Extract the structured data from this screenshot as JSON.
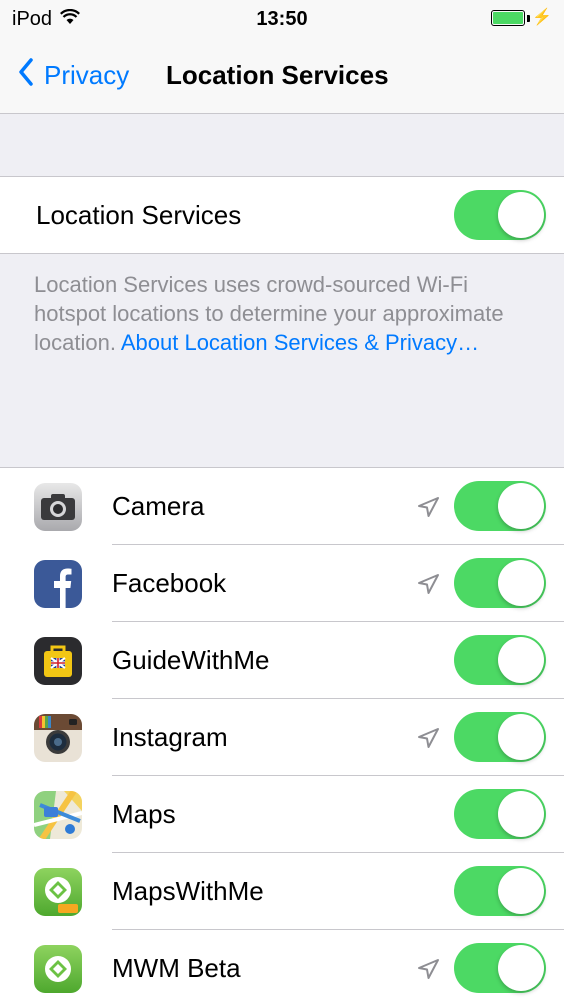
{
  "status_bar": {
    "device": "iPod",
    "time": "13:50",
    "battery_color": "#4cd964",
    "charging_symbol": "⚡"
  },
  "nav": {
    "back_label": "Privacy",
    "title": "Location Services"
  },
  "location_toggle": {
    "label": "Location Services",
    "on": true
  },
  "footer": {
    "text": "Location Services uses crowd-sourced Wi-Fi hotspot locations to determine your approximate location.",
    "link": "About Location Services & Privacy…"
  },
  "apps": [
    {
      "name": "Camera",
      "icon": "camera-icon",
      "recent_location_arrow": true,
      "on": true
    },
    {
      "name": "Facebook",
      "icon": "facebook-icon",
      "recent_location_arrow": true,
      "on": true
    },
    {
      "name": "GuideWithMe",
      "icon": "guidewithme-icon",
      "recent_location_arrow": false,
      "on": true
    },
    {
      "name": "Instagram",
      "icon": "instagram-icon",
      "recent_location_arrow": true,
      "on": true
    },
    {
      "name": "Maps",
      "icon": "maps-icon",
      "recent_location_arrow": false,
      "on": true
    },
    {
      "name": "MapsWithMe",
      "icon": "mapswithme-icon",
      "recent_location_arrow": false,
      "on": true
    },
    {
      "name": "MWM Beta",
      "icon": "mwm-beta-icon",
      "recent_location_arrow": true,
      "on": true
    }
  ],
  "colors": {
    "accent": "#007aff",
    "switch_on": "#4cd964",
    "background": "#efeff4"
  }
}
